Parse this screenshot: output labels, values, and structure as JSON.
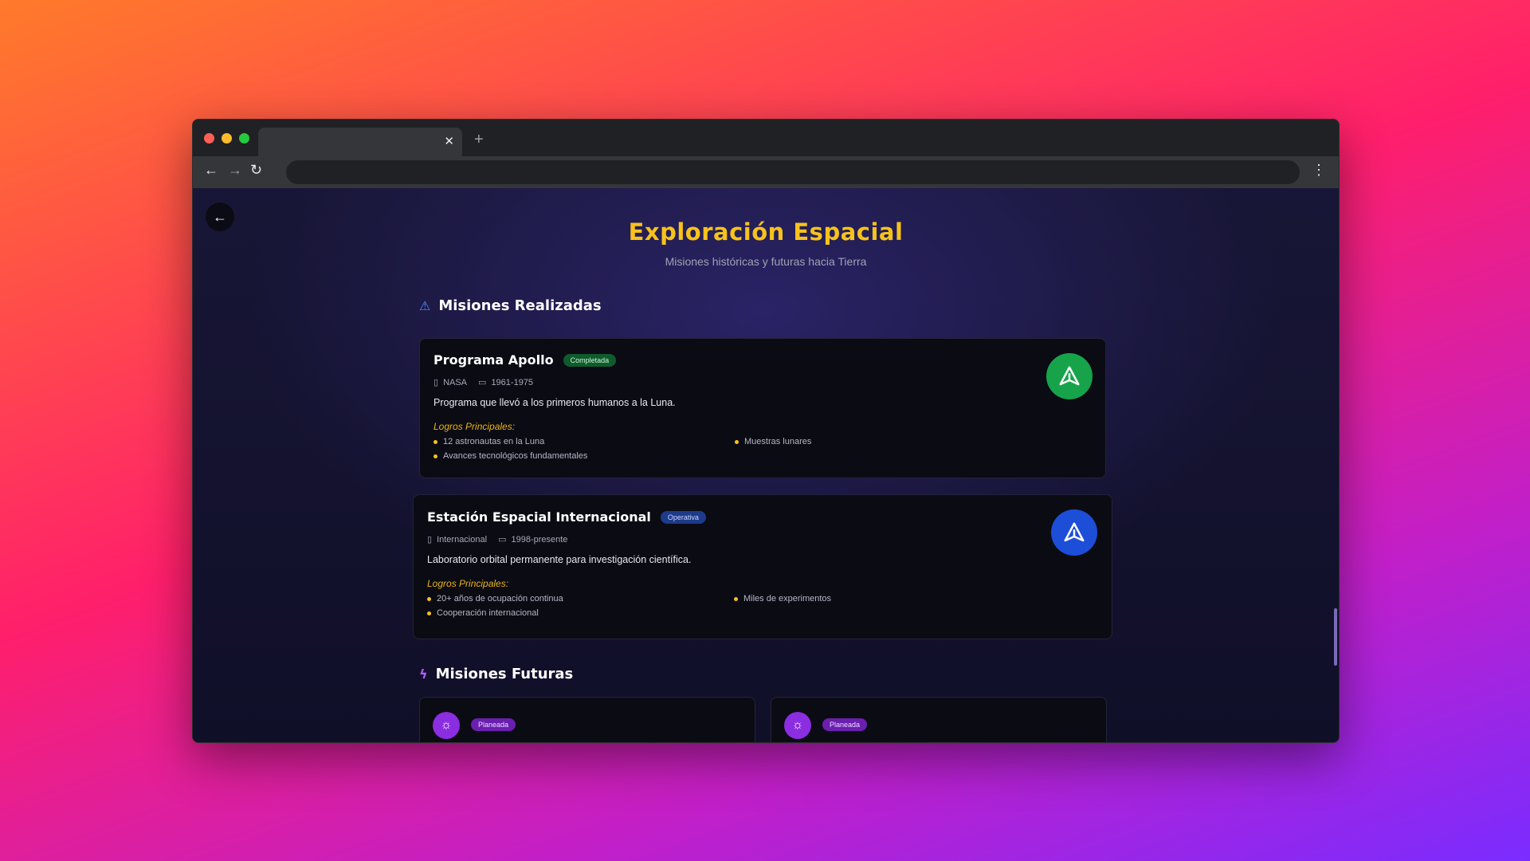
{
  "browser": {
    "tab_close": "✕",
    "new_tab": "+",
    "nav_back": "←",
    "nav_forward": "→",
    "nav_reload": "↻",
    "menu": "⋮",
    "traffic_colors": [
      "#ff5f57",
      "#febc2e",
      "#28c840"
    ]
  },
  "page": {
    "back_icon": "←",
    "title": "Exploración Espacial",
    "subtitle": "Misiones históricas y futuras hacia Tierra"
  },
  "sections": {
    "realizadas": {
      "icon": "⚠",
      "title": "Misiones Realizadas"
    },
    "futuras": {
      "icon": "ϟ",
      "title": "Misiones Futuras"
    }
  },
  "missions": [
    {
      "title": "Programa Apollo",
      "status": "Completada",
      "agency": "NASA",
      "years": "1961-1975",
      "description": "Programa que llevó a los primeros humanos a la Luna.",
      "achievements_label": "Logros Principales:",
      "achievements": [
        "12 astronautas en la Luna",
        "Muestras lunares",
        "Avances tecnológicos fundamentales"
      ],
      "accent": "#16a34a"
    },
    {
      "title": "Estación Espacial Internacional",
      "status": "Operativa",
      "agency": "Internacional",
      "years": "1998-presente",
      "description": "Laboratorio orbital permanente para investigación científica.",
      "achievements_label": "Logros Principales:",
      "achievements": [
        "20+ años de ocupación continua",
        "Miles de experimentos",
        "Cooperación internacional"
      ],
      "accent": "#1d4ed8"
    }
  ],
  "future": [
    {
      "status": "Planeada",
      "icon": "☼"
    },
    {
      "status": "Planeada",
      "icon": "☼"
    }
  ],
  "icons": {
    "agency": "▯",
    "calendar": "▭",
    "rocket": "⚠"
  }
}
